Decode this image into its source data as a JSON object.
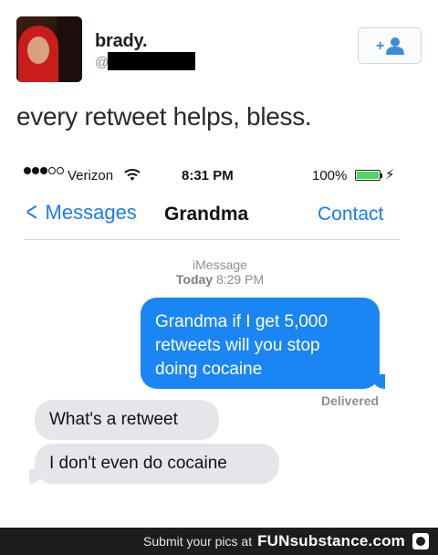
{
  "tweet": {
    "username": "brady.",
    "handle_prefix": "@",
    "text": "every retweet helps, bless.",
    "follow_icon": "add-user-icon"
  },
  "phone": {
    "status": {
      "signal_icon": "signal-dots-icon",
      "carrier": "Verizon",
      "wifi_icon": "wifi-icon",
      "time": "8:31 PM",
      "battery_pct": "100%",
      "charging_icon": "bolt-icon"
    },
    "nav": {
      "back_label": "Messages",
      "title": "Grandma",
      "contact_label": "Contact"
    },
    "thread": {
      "service": "iMessage",
      "day": "Today",
      "time": "8:29 PM",
      "outgoing": "Grandma if I get 5,000 retweets will you stop doing cocaine",
      "delivered": "Delivered",
      "incoming": [
        "What's a retweet",
        "I don't even do cocaine"
      ]
    }
  },
  "footer": {
    "prefix": "Submit your pics at",
    "brand": "FUNsubstance.com"
  },
  "colors": {
    "ios_blue": "#1a86f4",
    "battery_green": "#4cd964",
    "incoming_bubble": "#e6e6ea"
  }
}
